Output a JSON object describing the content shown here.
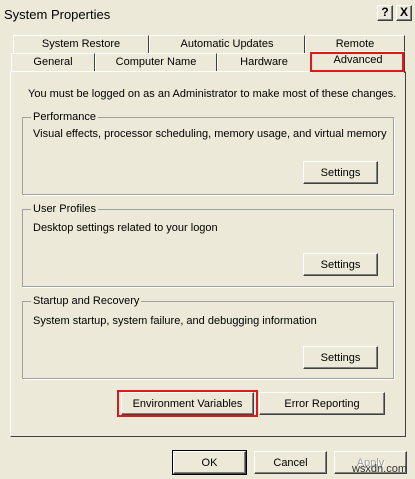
{
  "window": {
    "title": "System Properties",
    "help_label": "?",
    "close_label": "X"
  },
  "tabs": {
    "row_back": [
      "System Restore",
      "Automatic Updates",
      "Remote"
    ],
    "row_front": [
      "General",
      "Computer Name",
      "Hardware",
      "Advanced"
    ],
    "active": "Advanced"
  },
  "advanced": {
    "note": "You must be logged on as an Administrator to make most of these changes.",
    "groups": [
      {
        "title": "Performance",
        "description": "Visual effects, processor scheduling, memory usage, and virtual memory",
        "button": "Settings"
      },
      {
        "title": "User Profiles",
        "description": "Desktop settings related to your logon",
        "button": "Settings"
      },
      {
        "title": "Startup and Recovery",
        "description": "System startup, system failure, and debugging information",
        "button": "Settings"
      }
    ],
    "environment_variables": "Environment Variables",
    "error_reporting": "Error Reporting"
  },
  "footer": {
    "ok": "OK",
    "cancel": "Cancel",
    "apply": "Apply"
  },
  "watermark": "wsxdn.com",
  "highlight_color": "#e01818"
}
